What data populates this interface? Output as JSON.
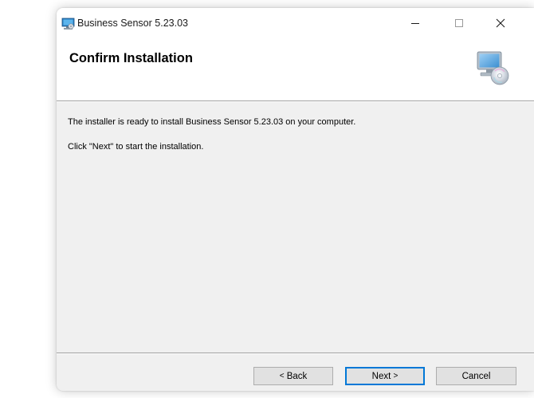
{
  "window": {
    "title": "Business Sensor 5.23.03",
    "controls": {
      "minimize_icon": "minimize-icon",
      "maximize_icon": "maximize-icon",
      "close_icon": "close-icon"
    }
  },
  "banner": {
    "title": "Confirm Installation",
    "icon": "computer-disc-icon"
  },
  "body": {
    "line1": "The installer is ready to install Business Sensor 5.23.03 on your computer.",
    "line2": "Click \"Next\" to start the installation."
  },
  "buttons": {
    "back_chevron": "<",
    "back_label": " Back",
    "next_label": "Next ",
    "next_chevron": ">",
    "cancel_label": "Cancel"
  },
  "colors": {
    "accent": "#0078d7",
    "dialog_bg": "#f0f0f0"
  }
}
